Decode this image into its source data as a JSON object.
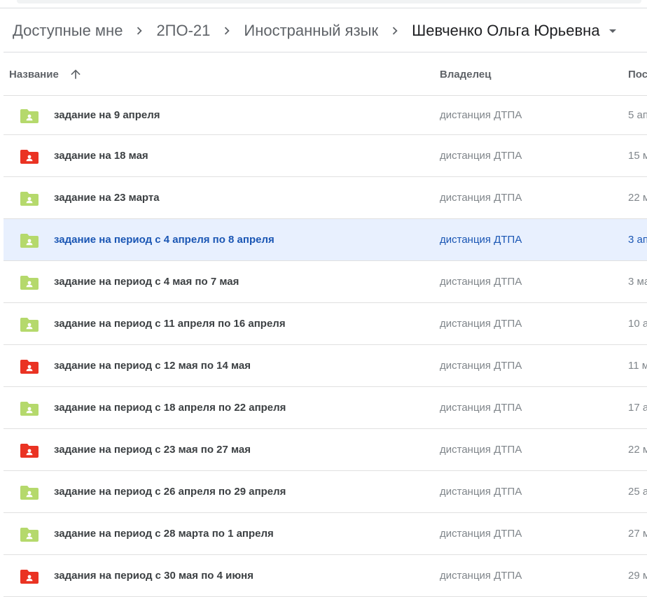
{
  "breadcrumb": {
    "items": [
      "Доступные мне",
      "2ПО-21",
      "Иностранный язык",
      "Шевченко Ольга Юрьевна"
    ]
  },
  "columns": {
    "name": "Название",
    "owner": "Владелец",
    "modified": "Пос"
  },
  "colors": {
    "folder_green": "#b5d96c",
    "folder_red": "#ea3323",
    "selected_bg": "#e8f0fe",
    "selected_text": "#1a56b4"
  },
  "rows": [
    {
      "name": "задание на 9 апреля",
      "owner": "дистанция ДТПА",
      "modified": "5 ап",
      "folder_color": "green",
      "selected": false
    },
    {
      "name": "задание на 18 мая",
      "owner": "дистанция ДТПА",
      "modified": "15 м",
      "folder_color": "red",
      "selected": false
    },
    {
      "name": "задание на 23 марта",
      "owner": "дистанция ДТПА",
      "modified": "22 м",
      "folder_color": "green",
      "selected": false
    },
    {
      "name": "задание на период с 4 апреля по 8 апреля",
      "owner": "дистанция ДТПА",
      "modified": "3 ап",
      "folder_color": "green",
      "selected": true
    },
    {
      "name": "задание на период с 4 мая по 7 мая",
      "owner": "дистанция ДТПА",
      "modified": "3 ма",
      "folder_color": "green",
      "selected": false
    },
    {
      "name": "задание на период с 11 апреля по 16 апреля",
      "owner": "дистанция ДТПА",
      "modified": "10 а",
      "folder_color": "green",
      "selected": false
    },
    {
      "name": "задание на период с 12 мая по 14 мая",
      "owner": "дистанция ДТПА",
      "modified": "11 м",
      "folder_color": "red",
      "selected": false
    },
    {
      "name": "задание на период с 18 апреля по 22 апреля",
      "owner": "дистанция ДТПА",
      "modified": "17 а",
      "folder_color": "green",
      "selected": false
    },
    {
      "name": "задание на период с 23 мая по 27 мая",
      "owner": "дистанция ДТПА",
      "modified": "22 м",
      "folder_color": "red",
      "selected": false
    },
    {
      "name": "задание на период с 26 апреля по 29 апреля",
      "owner": "дистанция ДТПА",
      "modified": "25 а",
      "folder_color": "green",
      "selected": false
    },
    {
      "name": "задание на период с 28 марта по 1 апреля",
      "owner": "дистанция ДТПА",
      "modified": "27 м",
      "folder_color": "green",
      "selected": false
    },
    {
      "name": "задания на период с 30 мая по 4 июня",
      "owner": "дистанция ДТПА",
      "modified": "29 м",
      "folder_color": "red",
      "selected": false
    }
  ]
}
